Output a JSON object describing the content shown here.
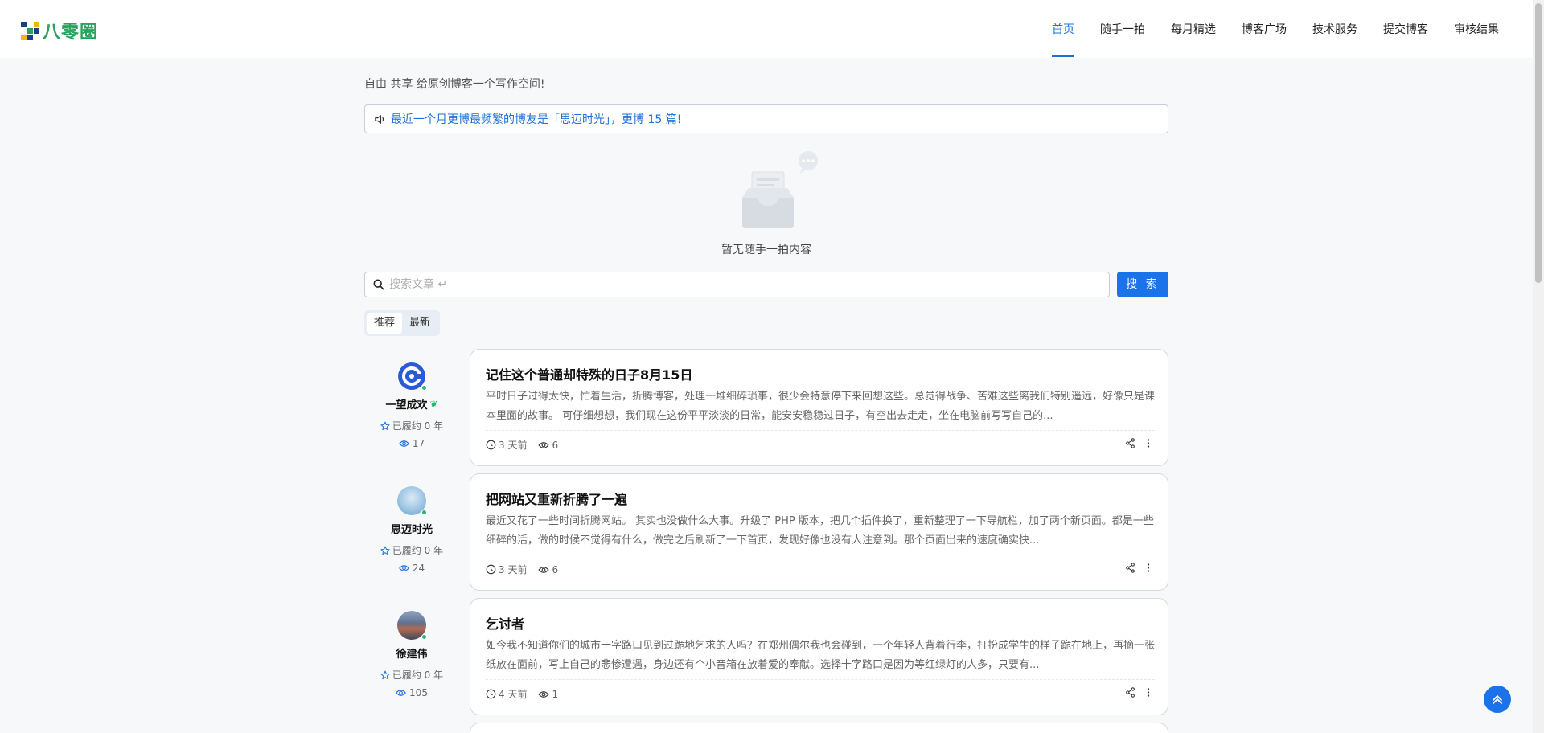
{
  "header": {
    "logo_text": "八零圈",
    "nav": [
      {
        "label": "首页",
        "active": true
      },
      {
        "label": "随手一拍"
      },
      {
        "label": "每月精选"
      },
      {
        "label": "博客广场"
      },
      {
        "label": "技术服务"
      },
      {
        "label": "提交博客"
      },
      {
        "label": "审核结果"
      }
    ]
  },
  "main": {
    "tagline": "自由 共享 给原创博客一个写作空间!",
    "notice": "最近一个月更博最频繁的博友是「思迈时光」，更博 15 篇!",
    "empty_text": "暂无随手一拍内容",
    "search": {
      "placeholder": "搜索文章 ↵",
      "button_label": "搜 索"
    },
    "tabs": [
      "推荐",
      "最新"
    ]
  },
  "posts": [
    {
      "author": "一望成欢",
      "author_badge": "leaf-icon",
      "author_tenure": "已履约 0 年",
      "author_views": "17",
      "avatar_color": "#2a5bd7",
      "title": "记住这个普通却特殊的日子8月15日",
      "excerpt": "平时日子过得太快，忙着生活，折腾博客，处理一堆细碎琐事，很少会特意停下来回想这些。总觉得战争、苦难这些离我们特别遥远，好像只是课本里面的故事。 可仔细想想，我们现在这份平平淡淡的日常，能安安稳稳过日子，有空出去走走，坐在电脑前写写自己的...",
      "time": "3 天前",
      "views": "6"
    },
    {
      "author": "思迈时光",
      "author_tenure": "已履约 0 年",
      "author_views": "24",
      "avatar_color": "#7fb3d9",
      "title": "把网站又重新折腾了一遍",
      "excerpt": "最近又花了一些时间折腾网站。 其实也没做什么大事。升级了 PHP 版本，把几个插件换了，重新整理了一下导航栏，加了两个新页面。都是一些细碎的活，做的时候不觉得有什么，做完之后刷新了一下首页，发现好像也没有人注意到。那个页面出来的速度确实快...",
      "time": "3 天前",
      "views": "6"
    },
    {
      "author": "徐建伟",
      "author_tenure": "已履约 0 年",
      "author_views": "105",
      "avatar_color": "#6d7f9a",
      "title": "乞讨者",
      "excerpt": "如今我不知道你们的城市十字路口见到过跪地乞求的人吗？在郑州偶尔我也会碰到，一个年轻人背着行李，打扮成学生的样子跪在地上，再摘一张纸放在面前，写上自己的悲惨遭遇，身边还有个小音箱在放着爱的奉献。选择十字路口是因为等红绿灯的人多，只要有...",
      "time": "4 天前",
      "views": "1"
    }
  ],
  "colors": {
    "accent": "#1a73e8",
    "online": "#2bb673"
  }
}
